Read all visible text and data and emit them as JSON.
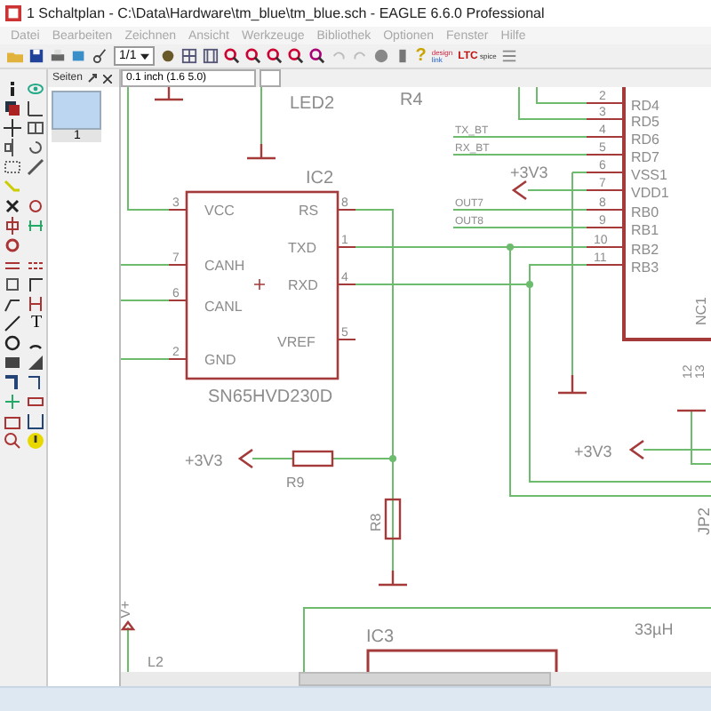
{
  "window": {
    "title": "1 Schaltplan - C:\\Data\\Hardware\\tm_blue\\tm_blue.sch - EAGLE 6.6.0 Professional"
  },
  "menu": [
    {
      "label": "Datei",
      "disabled": true
    },
    {
      "label": "Bearbeiten",
      "disabled": true
    },
    {
      "label": "Zeichnen",
      "disabled": true
    },
    {
      "label": "Ansicht",
      "disabled": true
    },
    {
      "label": "Werkzeuge",
      "disabled": true
    },
    {
      "label": "Bibliothek",
      "disabled": true
    },
    {
      "label": "Optionen",
      "disabled": true
    },
    {
      "label": "Fenster",
      "disabled": true
    },
    {
      "label": "Hilfe",
      "disabled": true
    }
  ],
  "toolbar": {
    "sheet": "1/1",
    "help": "?",
    "logos": [
      "design",
      "link",
      "LTC",
      "spice"
    ]
  },
  "tools": {
    "text_tool": "T"
  },
  "pages_panel": {
    "title": "Seiten",
    "pages": [
      {
        "label": "1",
        "selected": true
      }
    ]
  },
  "coordinates": "0.1 inch (1.6 5.0)",
  "schematic": {
    "top_labels": [
      "LED2",
      "R4"
    ],
    "ic2": {
      "name": "IC2",
      "value": "SN65HVD230D",
      "pins": [
        {
          "number": "3",
          "label": "VCC"
        },
        {
          "number": "7",
          "label": "CANH"
        },
        {
          "number": "6",
          "label": "CANL"
        },
        {
          "number": "2",
          "label": "GND"
        },
        {
          "number": "8",
          "label": "RS"
        },
        {
          "number": "1",
          "label": "TXD"
        },
        {
          "number": "4",
          "label": "RXD"
        },
        {
          "number": "5",
          "label": "VREF"
        }
      ]
    },
    "connector_pins": [
      {
        "number": "2",
        "label": "RD4"
      },
      {
        "number": "3",
        "label": "RD5"
      },
      {
        "number": "4",
        "label": "RD6"
      },
      {
        "number": "5",
        "label": "RD7"
      },
      {
        "number": "6",
        "label": "VSS1"
      },
      {
        "number": "7",
        "label": "VDD1"
      },
      {
        "number": "8",
        "label": "RB0"
      },
      {
        "number": "9",
        "label": "RB1"
      },
      {
        "number": "10",
        "label": "RB2"
      },
      {
        "number": "11",
        "label": "RB3"
      }
    ],
    "net_labels": [
      "TX_BT",
      "RX_BT",
      "OUT7",
      "OUT8"
    ],
    "supplies": [
      "+3V3",
      "+3V3",
      "+3V3",
      "V+"
    ],
    "resistors": [
      "R9",
      "R8"
    ],
    "other_labels": [
      "NC1",
      "12",
      "13",
      "JP2",
      "IC3",
      "33µH",
      "L2"
    ]
  }
}
